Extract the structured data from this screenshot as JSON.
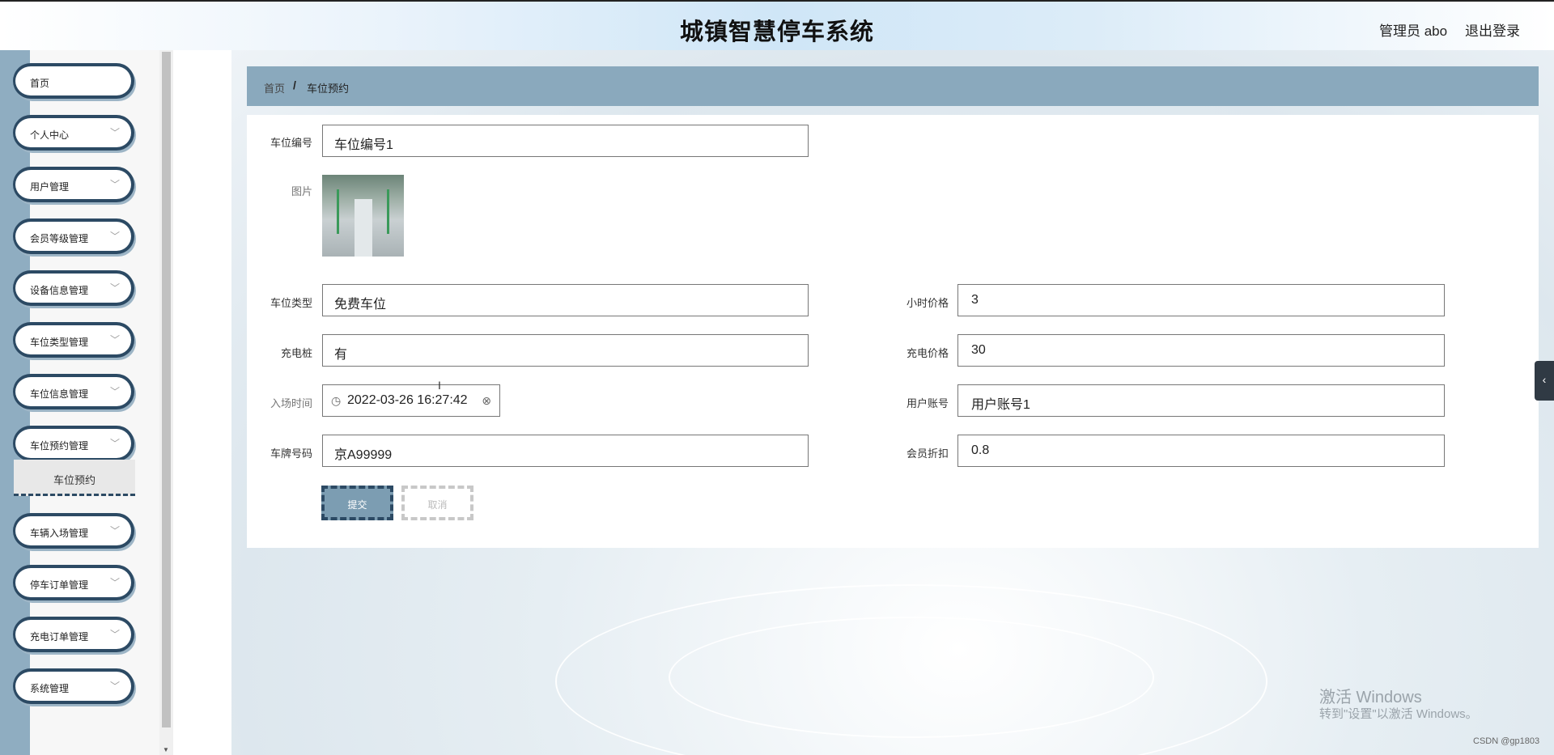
{
  "header": {
    "title": "城镇智慧停车系统",
    "admin": "管理员 abo",
    "logout": "退出登录"
  },
  "sidebar": {
    "items": [
      {
        "label": "首页",
        "has_chevron": false
      },
      {
        "label": "个人中心",
        "has_chevron": true
      },
      {
        "label": "用户管理",
        "has_chevron": true
      },
      {
        "label": "会员等级管理",
        "has_chevron": true
      },
      {
        "label": "设备信息管理",
        "has_chevron": true
      },
      {
        "label": "车位类型管理",
        "has_chevron": true
      },
      {
        "label": "车位信息管理",
        "has_chevron": true
      },
      {
        "label": "车位预约管理",
        "has_chevron": true
      },
      {
        "label": "车辆入场管理",
        "has_chevron": true
      },
      {
        "label": "停车订单管理",
        "has_chevron": true
      },
      {
        "label": "充电订单管理",
        "has_chevron": true
      },
      {
        "label": "系统管理",
        "has_chevron": true
      }
    ],
    "submenu_active": "车位预约",
    "chevron_icon": "chevron-down-icon"
  },
  "breadcrumb": {
    "home": "首页",
    "separator": "/",
    "current": "车位预约"
  },
  "form": {
    "space_no": {
      "label": "车位编号",
      "value": "车位编号1"
    },
    "image": {
      "label": "图片"
    },
    "space_type": {
      "label": "车位类型",
      "value": "免费车位"
    },
    "hour_price": {
      "label": "小时价格",
      "value": "3"
    },
    "charger": {
      "label": "充电桩",
      "value": "有"
    },
    "charge_price": {
      "label": "充电价格",
      "value": "30"
    },
    "entry_time": {
      "label": "入场时间",
      "value": "2022-03-26 16:27:42"
    },
    "user_account": {
      "label": "用户账号",
      "value": "用户账号1"
    },
    "plate": {
      "label": "车牌号码",
      "value": "京A99999"
    },
    "member_discount": {
      "label": "会员折扣",
      "value": "0.8"
    },
    "submit": "提交",
    "cancel": "取消"
  },
  "overlay": {
    "activate_title": "激活 Windows",
    "activate_hint": "转到\"设置\"以激活 Windows。",
    "csdn": "CSDN @gp1803"
  },
  "colors": {
    "accent": "#2c4a64",
    "breadcrumb_bg": "#8aa9bd",
    "submit_bg": "#7c9db2"
  }
}
